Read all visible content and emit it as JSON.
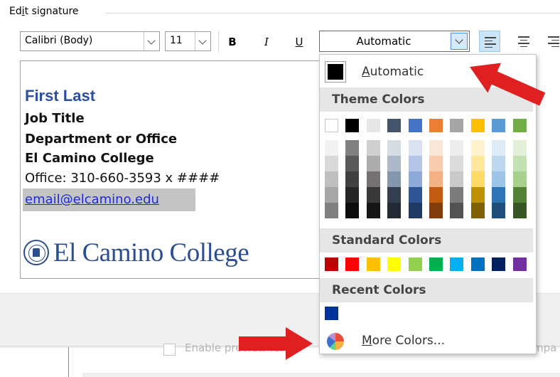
{
  "header": {
    "title_prefix": "Ed",
    "title_underlined": "i",
    "title_suffix": "t signature"
  },
  "toolbar": {
    "font_name": "Calibri (Body)",
    "font_size": "11",
    "bold_label": "B",
    "italic_label": "I",
    "underline_label": "U",
    "font_color": "Automatic"
  },
  "signature": {
    "name": "First Last",
    "title": "Job Title",
    "department": "Department or Office",
    "college": "El Camino College",
    "office": "Office: 310-660-3593 x ####",
    "email": "email@elcamino.edu",
    "logo_text": "El Camino College"
  },
  "color_menu": {
    "automatic_prefix": "",
    "automatic_underlined": "A",
    "automatic_suffix": "utomatic",
    "theme_title": "Theme Colors",
    "standard_title": "Standard Colors",
    "recent_title": "Recent Colors",
    "more_underlined": "M",
    "more_suffix": "ore Colors...",
    "theme_top": [
      "#ffffff",
      "#000000",
      "#e7e6e6",
      "#44546a",
      "#4472c4",
      "#ed7d31",
      "#a5a5a5",
      "#ffc000",
      "#5b9bd5",
      "#70ad47"
    ],
    "theme_shades": [
      [
        "#f2f2f2",
        "#d9d9d9",
        "#bfbfbf",
        "#a6a6a6",
        "#808080"
      ],
      [
        "#808080",
        "#595959",
        "#404040",
        "#262626",
        "#0d0d0d"
      ],
      [
        "#d0cece",
        "#aeabab",
        "#757171",
        "#3a3838",
        "#171616"
      ],
      [
        "#d6dce4",
        "#adb9ca",
        "#8497b0",
        "#333f4f",
        "#222a35"
      ],
      [
        "#d9e2f3",
        "#b4c6e7",
        "#8eaadb",
        "#2f5496",
        "#1f3864"
      ],
      [
        "#fbe5d5",
        "#f7cbac",
        "#f4b183",
        "#c55a11",
        "#833c0b"
      ],
      [
        "#ededed",
        "#dbdbdb",
        "#c9c9c9",
        "#7b7b7b",
        "#525252"
      ],
      [
        "#fff2cc",
        "#ffe699",
        "#ffd966",
        "#bf9000",
        "#7f6000"
      ],
      [
        "#deebf6",
        "#bdd7ee",
        "#9dc3e6",
        "#2e75b5",
        "#1f4e79"
      ],
      [
        "#e2efd9",
        "#c5e0b3",
        "#a8d08d",
        "#538135",
        "#375623"
      ]
    ],
    "standard": [
      "#c00000",
      "#ff0000",
      "#ffc000",
      "#ffff00",
      "#92d050",
      "#00b050",
      "#00b0f0",
      "#0070c0",
      "#002060",
      "#7030a0"
    ],
    "recent": [
      "#003399"
    ]
  },
  "footer": {
    "preview_label": "Enable preview for R",
    "preview_tail": "mpa"
  },
  "colors": {
    "arrow": "#e02020",
    "accent": "#2c4ea0",
    "link": "#1e2dcf"
  }
}
